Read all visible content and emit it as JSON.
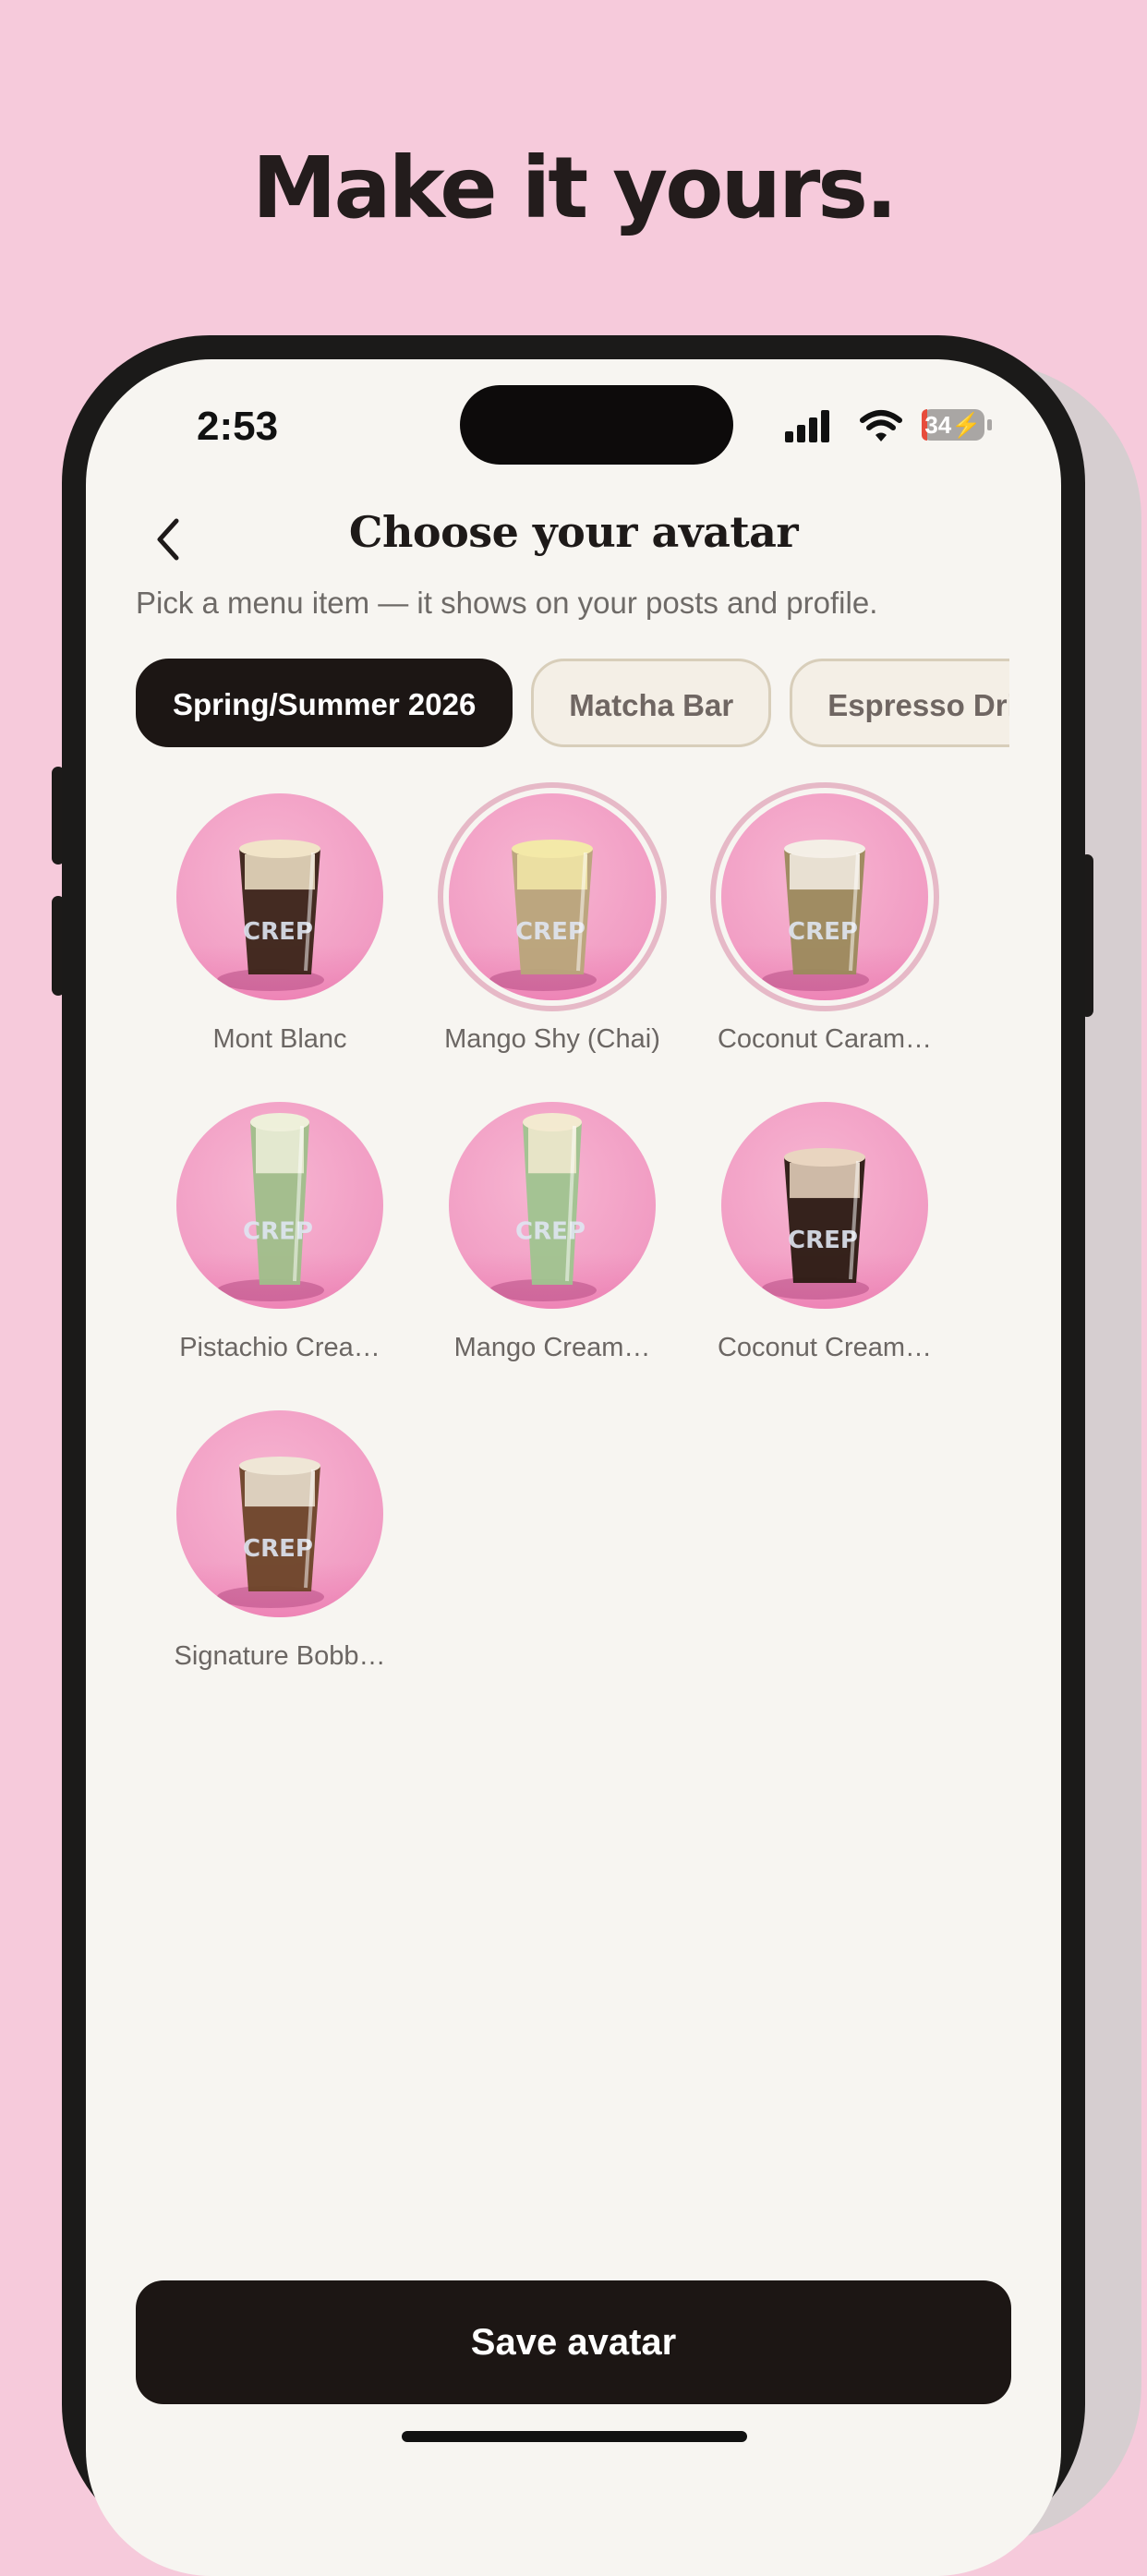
{
  "headline": "Make it yours.",
  "status_bar": {
    "time": "2:53",
    "battery": "34"
  },
  "nav": {
    "title": "Choose your avatar",
    "back_icon": "chevron-left-icon"
  },
  "subtitle": "Pick a menu item — it shows on your posts and profile.",
  "tabs": [
    {
      "label": "Spring/Summer 2026",
      "active": true
    },
    {
      "label": "Matcha Bar",
      "active": false
    },
    {
      "label": "Espresso Drinks",
      "active": false
    }
  ],
  "avatars": [
    {
      "label": "Mont Blanc",
      "drink_color": "#3a2418",
      "top_color": "#f1e4c8"
    },
    {
      "label": "Mango Shy (Chai)",
      "drink_color": "#b8a57a",
      "top_color": "#f3e9a8",
      "highlighted": true
    },
    {
      "label": "Coconut Caram…",
      "drink_color": "#9b8a5c",
      "top_color": "#f4efe6",
      "highlighted": true
    },
    {
      "label": "Pistachio Crea…",
      "drink_color": "#9fbf8a",
      "top_color": "#eef0da"
    },
    {
      "label": "Mango Cream…",
      "drink_color": "#9fc48f",
      "top_color": "#f3ead0"
    },
    {
      "label": "Coconut Cream…",
      "drink_color": "#2a1a12",
      "top_color": "#e9d5c0"
    },
    {
      "label": "Signature Bobb…",
      "drink_color": "#6b4428",
      "top_color": "#efe6d6"
    }
  ],
  "save_button": "Save avatar",
  "colors": {
    "background": "#f6cadb",
    "primary": "#1c1614",
    "screen": "#f7f5f1"
  }
}
